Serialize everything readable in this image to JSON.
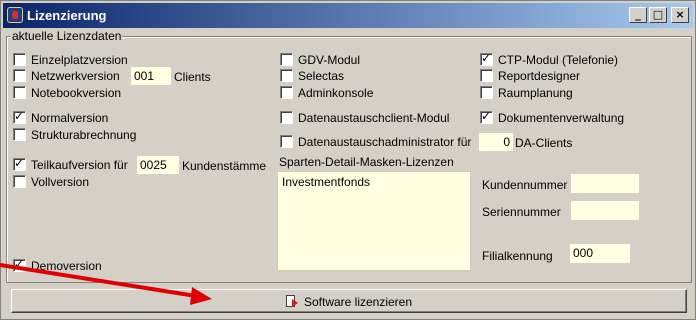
{
  "window": {
    "title": "Lizenzierung",
    "controls": {
      "minimize": "_",
      "maximize": "□",
      "close": "×"
    }
  },
  "group": {
    "label": "aktuelle Lizenzdaten"
  },
  "checkboxes": {
    "einzelplatz": {
      "label": "Einzelplatzversion",
      "checked": false
    },
    "netzwerk": {
      "label": "Netzwerkversion",
      "checked": false,
      "value": "001",
      "suffix": "Clients"
    },
    "notebook": {
      "label": "Notebookversion",
      "checked": false
    },
    "normal": {
      "label": "Normalversion",
      "checked": true
    },
    "struktur": {
      "label": "Strukturabrechnung",
      "checked": false
    },
    "teilkauf": {
      "label": "Teilkaufversion für",
      "checked": true,
      "value": "0025",
      "suffix": "Kundenstämme"
    },
    "voll": {
      "label": "Vollversion",
      "checked": false
    },
    "demo": {
      "label": "Demoversion",
      "checked": true
    },
    "gdv": {
      "label": "GDV-Modul",
      "checked": false
    },
    "selectas": {
      "label": "Selectas",
      "checked": false
    },
    "admin": {
      "label": "Adminkonsole",
      "checked": false
    },
    "dtaclient": {
      "label": "Datenaustauschclient-Modul",
      "checked": false
    },
    "dtaadmin": {
      "label": "Datenaustauschadministrator für",
      "checked": false,
      "value": "0",
      "suffix": "DA-Clients"
    },
    "ctp": {
      "label": "CTP-Modul (Telefonie)",
      "checked": true
    },
    "report": {
      "label": "Reportdesigner",
      "checked": false
    },
    "raum": {
      "label": "Raumplanung",
      "checked": false
    },
    "doku": {
      "label": "Dokumentenverwaltung",
      "checked": true
    }
  },
  "sparten": {
    "label": "Sparten-Detail-Masken-Lizenzen",
    "items": [
      "Investmentfonds"
    ]
  },
  "fields": {
    "kundennummer": {
      "label": "Kundennummer",
      "value": ""
    },
    "seriennummer": {
      "label": "Seriennummer",
      "value": ""
    },
    "filialkennung": {
      "label": "Filialkennung",
      "value": "000"
    }
  },
  "button": {
    "label": "Software lizenzieren",
    "icon": "license-doc-icon"
  },
  "colors": {
    "titlebar_start": "#0a246a",
    "titlebar_end": "#a6caf0",
    "field_bg": "#ffffe1",
    "annotation_arrow": "#e00000"
  }
}
